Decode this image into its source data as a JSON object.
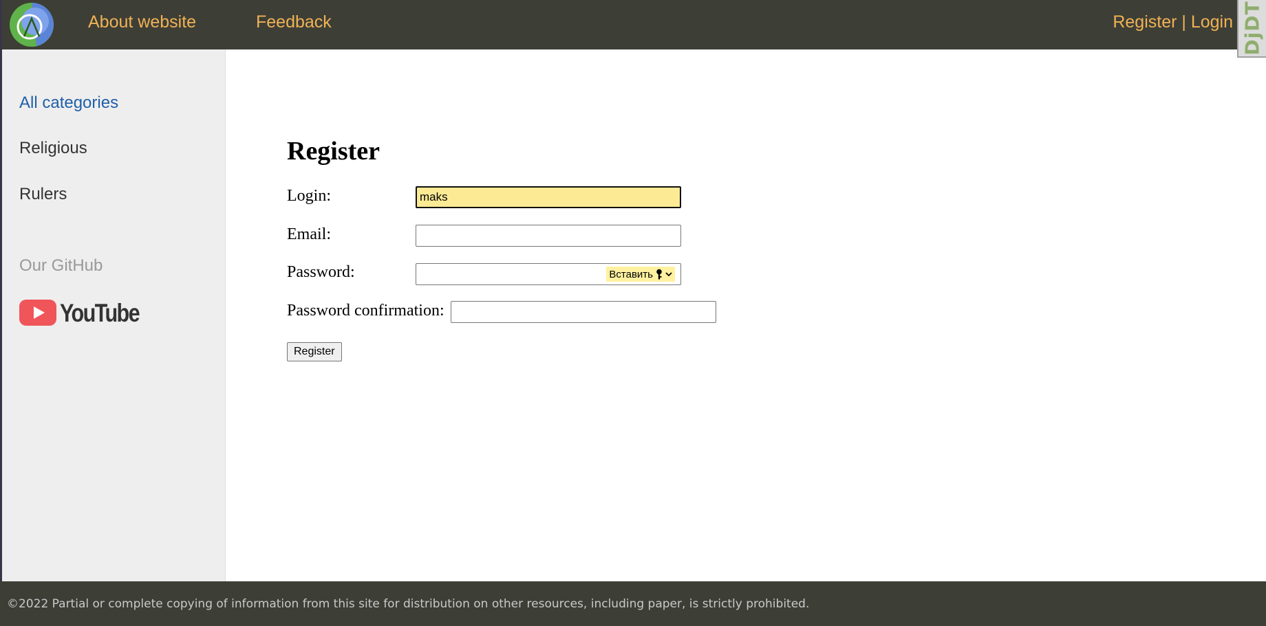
{
  "header": {
    "nav": {
      "about_label": "About website",
      "feedback_label": "Feedback"
    },
    "auth": {
      "register_label": "Register",
      "separator": " | ",
      "login_label": "Login"
    },
    "debug_toolbar_label": "DjDT"
  },
  "sidebar": {
    "items": [
      {
        "label": "All categories",
        "active": true
      },
      {
        "label": "Religious"
      },
      {
        "label": "Rulers"
      }
    ],
    "github_label": "Our GitHub",
    "youtube_label": "YouTube"
  },
  "form": {
    "title": "Register",
    "fields": {
      "login": {
        "label": "Login:",
        "value": "maks"
      },
      "email": {
        "label": "Email:",
        "value": ""
      },
      "password": {
        "label": "Password:",
        "value": "",
        "insert_label": "Вставить"
      },
      "password_confirm": {
        "label": "Password confirmation:",
        "value": ""
      }
    },
    "submit_label": "Register"
  },
  "footer": {
    "text": "©2022 Partial or complete copying of information from this site for distribution on other resources, including paper, is strictly prohibited."
  },
  "colors": {
    "header_bg": "#3d3e36",
    "nav_link": "#f0b255",
    "sidebar_bg": "#eeeeee",
    "active_link": "#1f5fa8",
    "focused_field": "#fdea95"
  },
  "icons": {
    "logo": "site-logo",
    "youtube": "youtube-logo",
    "key": "key-icon",
    "chevron": "chevron-down-icon"
  }
}
